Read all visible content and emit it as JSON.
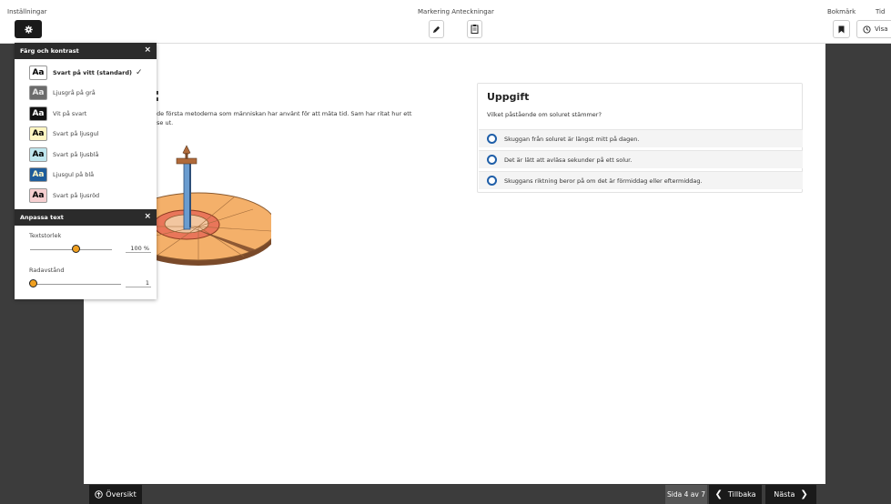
{
  "toolbar": {
    "settings_label": "Inställningar",
    "center_label": "Markering Anteckningar",
    "bookmark_label": "Bokmärk",
    "time_label": "Tid",
    "time_button": "Visa"
  },
  "content": {
    "heading_tail": ":",
    "intro_line1": "de första metoderna som människan har använt för att mäta tid. Sam har ritat hur ett",
    "intro_line2": "se ut."
  },
  "task": {
    "title": "Uppgift",
    "question": "Vilket påstående om soluret stämmer?",
    "options": [
      "Skuggan från soluret är längst mitt på dagen.",
      "Det är lätt att avläsa sekunder på ett solur.",
      "Skuggans riktning beror på om det är förmiddag eller eftermiddag."
    ]
  },
  "settings_panel": {
    "color_header": "Färg och kontrast",
    "close": "×",
    "schemes": [
      {
        "aa": "Aa",
        "label": "Svart på vitt (standard)",
        "selected": true,
        "bg": "#ffffff",
        "fg": "#000000"
      },
      {
        "aa": "Aa",
        "label": "Ljusgrå på grå",
        "selected": false,
        "bg": "#6b6b6b",
        "fg": "#e8e8e8"
      },
      {
        "aa": "Aa",
        "label": "Vit på svart",
        "selected": false,
        "bg": "#111111",
        "fg": "#ffffff"
      },
      {
        "aa": "Aa",
        "label": "Svart på ljusgul",
        "selected": false,
        "bg": "#fff6c2",
        "fg": "#000000"
      },
      {
        "aa": "Aa",
        "label": "Svart på ljusblå",
        "selected": false,
        "bg": "#bfe6ee",
        "fg": "#000000"
      },
      {
        "aa": "Aa",
        "label": "Ljusgul på blå",
        "selected": false,
        "bg": "#1f5d9a",
        "fg": "#fff8c8"
      },
      {
        "aa": "Aa",
        "label": "Svart på ljusröd",
        "selected": false,
        "bg": "#f6cfd0",
        "fg": "#000000"
      }
    ],
    "check": "✓",
    "text_header": "Anpassa text",
    "text_size_label": "Textstorlek",
    "text_size_value": "100 %",
    "text_size_fraction": 0.5,
    "line_spacing_label": "Radavstånd",
    "line_spacing_value": "1",
    "line_spacing_fraction": 0
  },
  "bottom": {
    "overview": "Översikt",
    "page_indicator": "Sida 4 av 7",
    "back": "Tillbaka",
    "next": "Nästa"
  },
  "colors": {
    "accent_radio": "#1e5ea8",
    "slider_knob": "#f0a020",
    "dark": "#1a1a1a"
  }
}
